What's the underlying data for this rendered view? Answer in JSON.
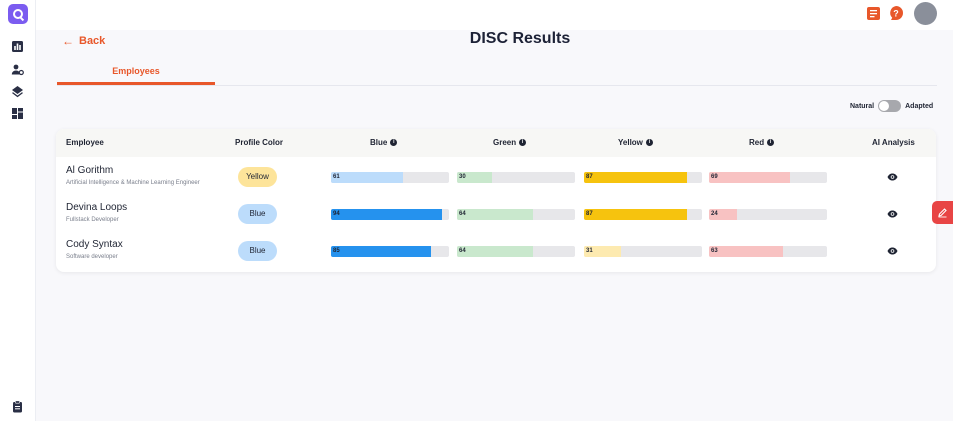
{
  "header": {
    "back_label": "Back",
    "title": "DISC Results"
  },
  "tabs": [
    {
      "label": "Employees",
      "active": true
    }
  ],
  "toggle": {
    "left_label": "Natural",
    "right_label": "Adapted",
    "state": "Natural"
  },
  "table": {
    "columns": {
      "employee": "Employee",
      "profile_color": "Profile Color",
      "blue": "Blue",
      "green": "Green",
      "yellow": "Yellow",
      "red": "Red",
      "ai_analysis": "AI Analysis"
    },
    "rows": [
      {
        "name": "Al Gorithm",
        "role": "Artificial Intelligence & Machine Learning Engineer",
        "profile_color": "Yellow",
        "blue": "61",
        "green": "30",
        "yellow": "87",
        "red": "69"
      },
      {
        "name": "Devina Loops",
        "role": "Fullstack Developer",
        "profile_color": "Blue",
        "blue": "94",
        "green": "64",
        "yellow": "87",
        "red": "24"
      },
      {
        "name": "Cody Syntax",
        "role": "Software developer",
        "profile_color": "Blue",
        "blue": "85",
        "green": "64",
        "yellow": "31",
        "red": "63"
      }
    ]
  },
  "colors": {
    "accent": "#e8572a",
    "brand": "#7b5cf0",
    "pill_yellow": "#fde49a",
    "pill_blue": "#bcdcfb",
    "blue_strong": "#2592ee",
    "blue_light": "#bcdcfb",
    "green_light": "#c9e8cd",
    "yellow_strong": "#f6c30e",
    "yellow_light": "#fdeab0",
    "red_light": "#f8c2c2"
  },
  "icons": {
    "logo": "q-logo-icon",
    "nav": [
      "bar-chart-icon",
      "user-settings-icon",
      "layers-icon",
      "dashboard-icon",
      "clipboard-icon"
    ],
    "top": [
      "document-icon",
      "help-icon",
      "avatar"
    ],
    "row_action": "eye-icon",
    "floating": "pen-icon"
  }
}
